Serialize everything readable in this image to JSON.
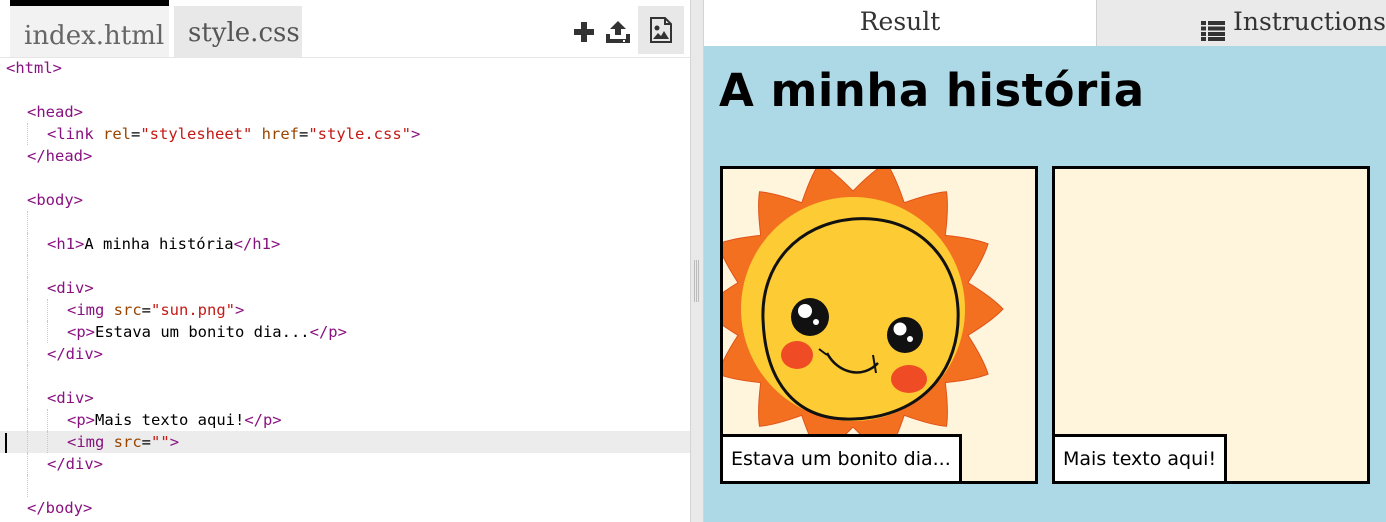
{
  "editor": {
    "tabs": [
      {
        "label": "index.html",
        "active": true
      },
      {
        "label": "style.css",
        "active": false
      }
    ],
    "toolbar": {
      "add_icon": "plus-icon",
      "upload_icon": "upload-icon",
      "image_icon": "image-icon"
    },
    "code_lines": [
      "<html>",
      "",
      "  <head>",
      "    <link rel=\"stylesheet\" href=\"style.css\">",
      "  </head>",
      "",
      "  <body>",
      "",
      "    <h1>A minha história</h1>",
      "",
      "    <div>",
      "      <img src=\"sun.png\">",
      "      <p>Estava um bonito dia...</p>",
      "    </div>",
      "",
      "    <div>",
      "      <p>Mais texto aqui!</p>",
      "      <img src=\"\">",
      "    </div>",
      "",
      "  </body>"
    ],
    "active_line": 18
  },
  "result": {
    "tabs": {
      "result_label": "Result",
      "instructions_label": "Instructions"
    },
    "preview": {
      "heading": "A minha história",
      "panels": [
        {
          "image": "sun.png",
          "caption": "Estava um bonito dia..."
        },
        {
          "image": "",
          "caption": "Mais texto aqui!"
        }
      ]
    }
  },
  "colors": {
    "tag": "#881280",
    "attribute": "#994500",
    "string": "#c41a16",
    "preview_background": "#add8e6",
    "panel_background": "#fff5dc",
    "sun_rays": "#f37021",
    "sun_face": "#fdcb33",
    "cheeks": "#ef4b25"
  }
}
